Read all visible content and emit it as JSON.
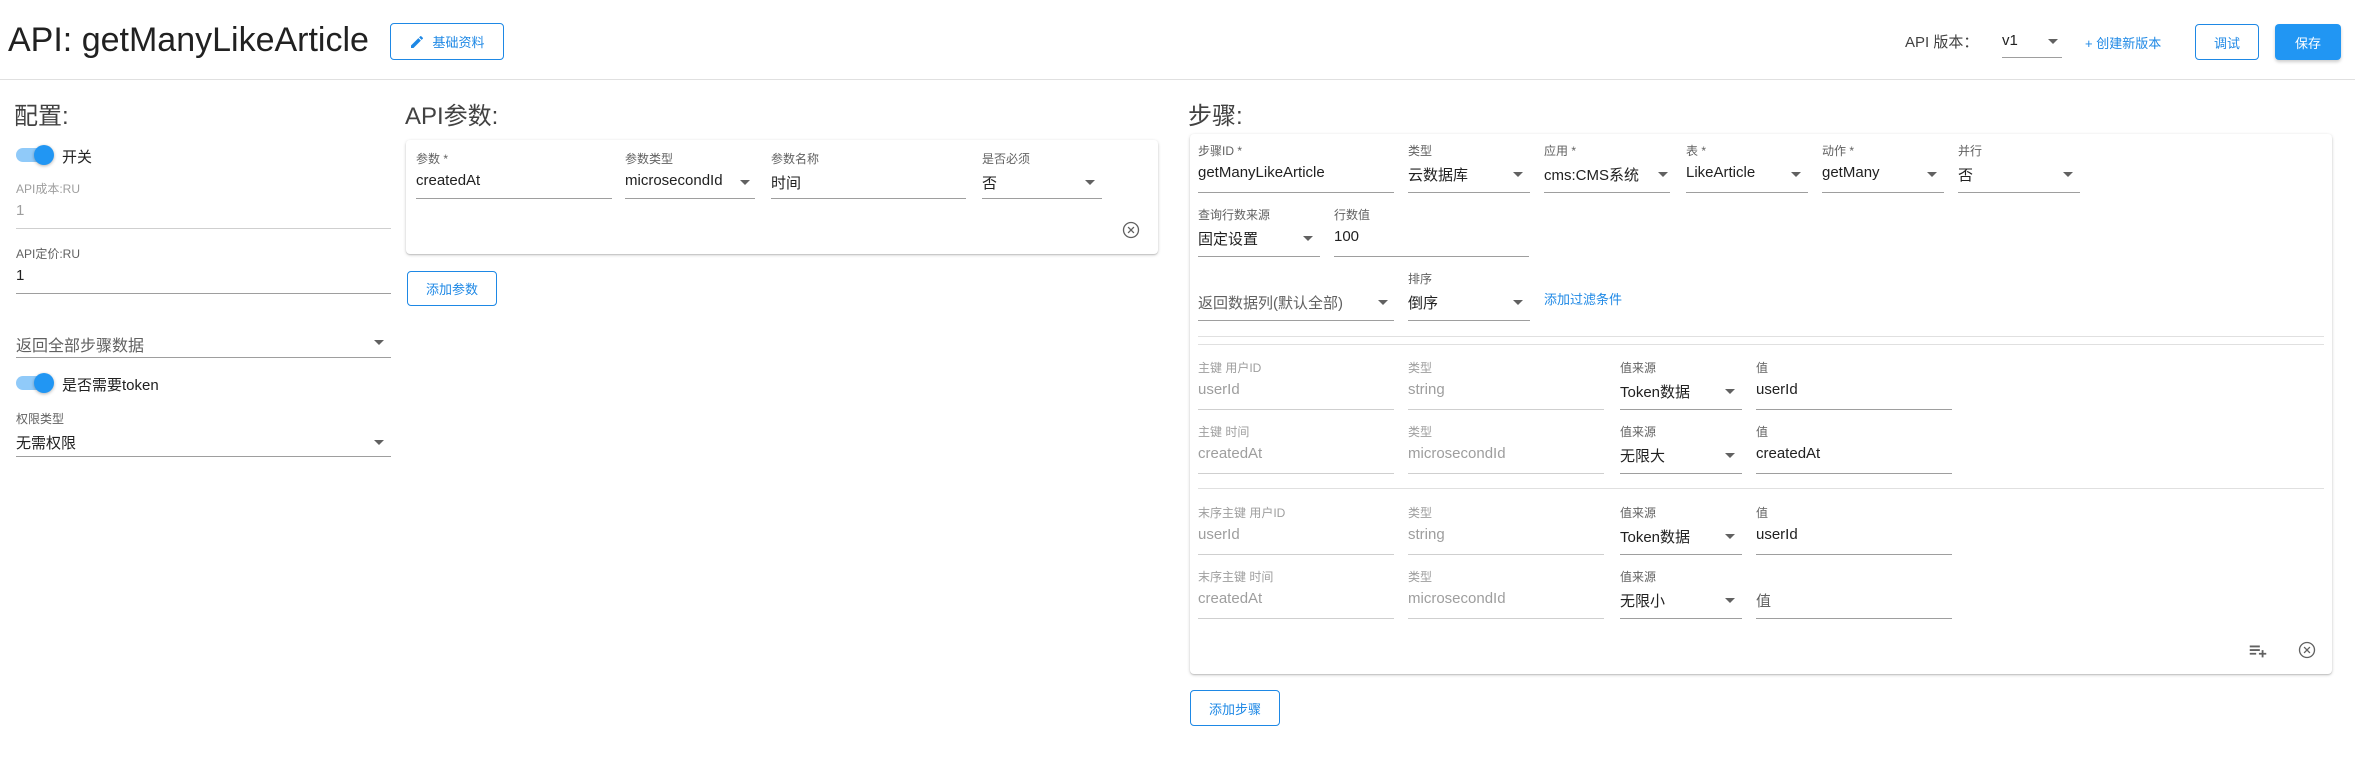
{
  "header": {
    "title": "API: getManyLikeArticle",
    "basic_info_button": "基础资料",
    "version_label": "API 版本：",
    "version_value": "v1",
    "create_version": "+ 创建新版本",
    "debug_button": "调试",
    "save_button": "保存"
  },
  "config": {
    "title": "配置:",
    "switch_label": "开关",
    "cost_label": "API成本:RU",
    "cost_value": "1",
    "price_label": "API定价:RU",
    "price_value": "1",
    "return_select": "返回全部步骤数据",
    "token_label": "是否需要token",
    "perm_label": "权限类型",
    "perm_value": "无需权限"
  },
  "params": {
    "title": "API参数:",
    "col_param": "参数 *",
    "col_type": "参数类型",
    "col_name": "参数名称",
    "col_required": "是否必须",
    "row": {
      "param": "createdAt",
      "type": "microsecondId",
      "name": "时间",
      "required": "否"
    },
    "add_button": "添加参数"
  },
  "steps": {
    "title": "步骤:",
    "step_id_label": "步骤ID *",
    "step_id_value": "getManyLikeArticle",
    "type_label": "类型",
    "type_value": "云数据库",
    "app_label": "应用 *",
    "app_value": "cms:CMS系统",
    "table_label": "表 *",
    "table_value": "LikeArticle",
    "action_label": "动作 *",
    "action_value": "getMany",
    "parallel_label": "并行",
    "parallel_value": "否",
    "rows_source_label": "查询行数来源",
    "rows_source_value": "固定设置",
    "rows_label": "行数值",
    "rows_value": "100",
    "columns_value": "返回数据列(默认全部)",
    "sort_label": "排序",
    "sort_value": "倒序",
    "add_filter": "添加过滤条件",
    "keys": [
      {
        "key_label": "主键  用户ID",
        "key_value": "userId",
        "type_label": "类型",
        "type_value": "string",
        "source_label": "值来源",
        "source_value": "Token数据",
        "value_label": "值",
        "value_value": "userId"
      },
      {
        "key_label": "主键  时间",
        "key_value": "createdAt",
        "type_label": "类型",
        "type_value": "microsecondId",
        "source_label": "值来源",
        "source_value": "无限大",
        "value_label": "值",
        "value_value": "createdAt"
      },
      {
        "key_label": "末序主键  用户ID",
        "key_value": "userId",
        "type_label": "类型",
        "type_value": "string",
        "source_label": "值来源",
        "source_value": "Token数据",
        "value_label": "值",
        "value_value": "userId"
      },
      {
        "key_label": "末序主键  时间",
        "key_value": "createdAt",
        "type_label": "类型",
        "type_value": "microsecondId",
        "source_label": "值来源",
        "source_value": "无限小",
        "value_label": "",
        "value_value": "值"
      }
    ],
    "add_step_button": "添加步骤"
  },
  "icons": {
    "edit": "pencil-icon",
    "close": "close-circle-icon",
    "playlist_add": "playlist-add-icon"
  },
  "colors": {
    "primary": "#2196f3",
    "accent_text": "#1e88e5"
  }
}
